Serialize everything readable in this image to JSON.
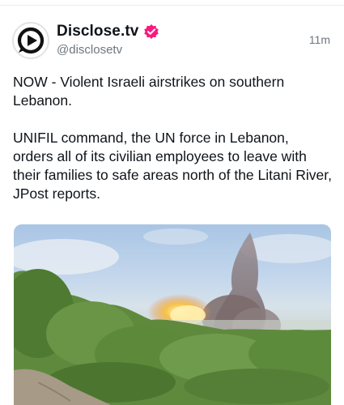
{
  "account": {
    "display_name": "Disclose.tv",
    "handle": "@disclosetv",
    "verified": true,
    "avatar_icon": "disclose-play-logo-icon"
  },
  "post": {
    "time_ago": "11m",
    "paragraphs": [
      "NOW - Violent Israeli airstrikes on southern Lebanon.",
      "UNIFIL command, the UN force in Lebanon, orders all of its civilian employees to leave with their families to safe areas north of the Litani River, JPost reports."
    ]
  },
  "colors": {
    "text": "#0f1419",
    "muted": "#6e767d",
    "verified_badge": "#f91880"
  }
}
